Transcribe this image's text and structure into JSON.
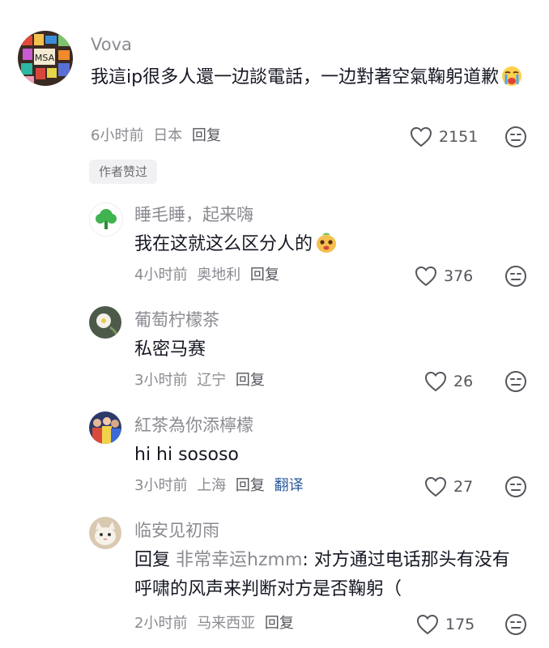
{
  "comments": [
    {
      "name": "Vova",
      "text": "我這ip很多人還一边談電話，一边對著空氣鞠躬道歉",
      "time": "6小时前",
      "location": "日本",
      "reply_label": "回复",
      "likes": "2151",
      "badge": "作者赞过",
      "emoji": "crying-face-emoji",
      "avatar_icon": "colorful-collage-avatar"
    },
    {
      "name": "睡毛睡，起来嗨",
      "text": "我在这就这么区分人的",
      "time": "4小时前",
      "location": "奥地利",
      "reply_label": "回复",
      "likes": "376",
      "emoji": "dog-face-emoji",
      "avatar_icon": "green-tree-avatar"
    },
    {
      "name": "葡萄柠檬茶",
      "text": "私密马赛",
      "time": "3小时前",
      "location": "辽宁",
      "reply_label": "回复",
      "likes": "26",
      "avatar_icon": "flower-avatar"
    },
    {
      "name": "紅茶為你添檸檬",
      "text": "hi hi sososo",
      "time": "3小时前",
      "location": "上海",
      "reply_label": "回复",
      "translate_label": "翻译",
      "likes": "27",
      "avatar_icon": "crowd-avatar"
    },
    {
      "name": "临安见初雨",
      "reply_prefix": "回复",
      "reply_target": "非常幸运hzmm",
      "text": ": 对方通过电话那头有没有呼啸的风声来判断对方是否鞠躬（",
      "time": "2小时前",
      "location": "马来西亚",
      "reply_label": "回复",
      "likes": "175",
      "avatar_icon": "cat-avatar"
    }
  ],
  "icons": {
    "like": "heart-outline-icon",
    "dislike": "neutral-face-icon"
  },
  "colors": {
    "name": "#8a8b91",
    "text": "#161823",
    "translate": "#2a5a9a",
    "badge_bg": "#f1f1f3"
  }
}
